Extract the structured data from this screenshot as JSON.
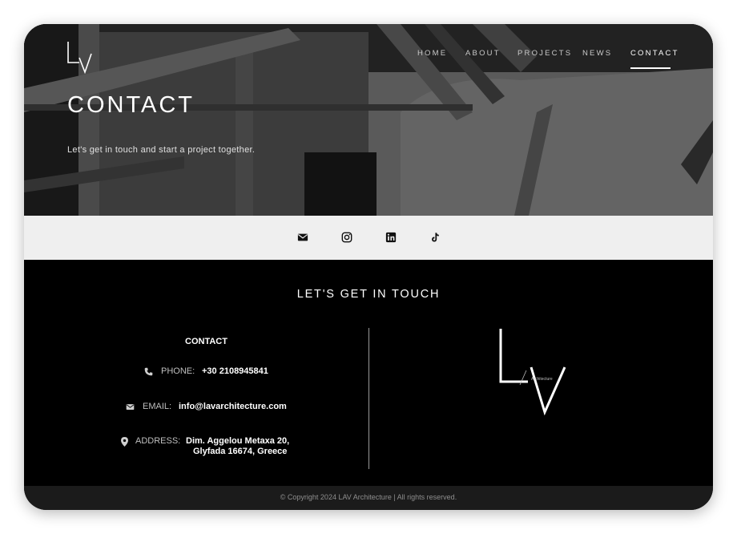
{
  "header": {
    "brand_letters": "LV",
    "nav": [
      {
        "label": "HOME"
      },
      {
        "label": "ABOUT"
      },
      {
        "label": "PROJECTS"
      },
      {
        "label": "NEWS"
      },
      {
        "label": "CONTACT",
        "active": true
      }
    ]
  },
  "hero": {
    "title": "CONTACT",
    "subtitle": "Let's get in touch and start a project together."
  },
  "social": {
    "icons": [
      "envelope-icon",
      "instagram-icon",
      "linkedin-icon",
      "tiktok-icon"
    ]
  },
  "main": {
    "heading": "LET'S GET IN TOUCH",
    "contact_heading": "CONTACT",
    "phone": {
      "label": "PHONE:",
      "value": "+30 2108945841"
    },
    "email": {
      "label": "EMAIL:",
      "value": "info@lavarchitecture.com"
    },
    "address": {
      "label": "ADDRESS:",
      "line1": "Dim. Aggelou Metaxa 20,",
      "line2": "Glyfada 16674, Greece"
    },
    "logo_caption": "Architecture"
  },
  "footer": {
    "copyright": "© Copyright 2024  LAV Architecture | All rights reserved."
  },
  "colors": {
    "background": "#000000",
    "social_band": "#efefef",
    "footer": "#1b1b1b",
    "text": "#ffffff"
  }
}
